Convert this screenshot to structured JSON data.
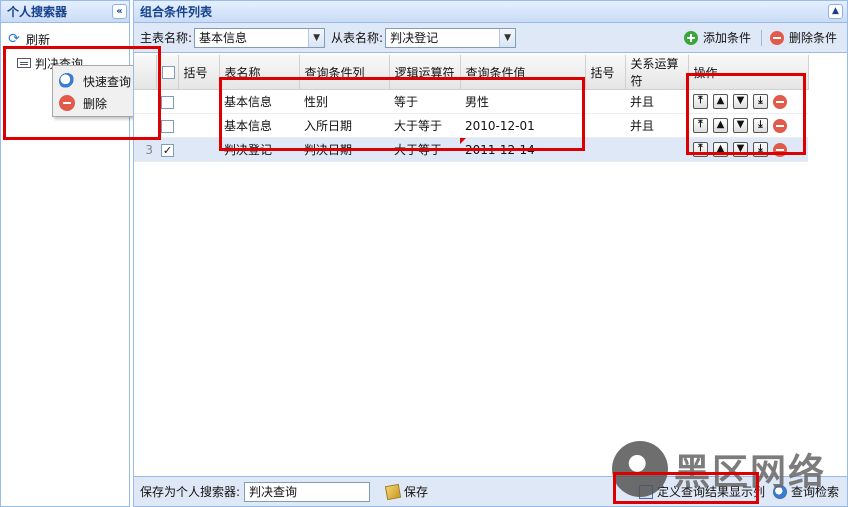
{
  "left_panel": {
    "title": "个人搜索器",
    "collapse_glyph": "«",
    "refresh_label": "刷新",
    "tree_items": [
      {
        "label": "判决查询",
        "icon": "form-icon"
      }
    ]
  },
  "context_menu": {
    "items": [
      {
        "label": "快速查询",
        "icon": "search-icon"
      },
      {
        "label": "删除",
        "icon": "delete-icon"
      }
    ]
  },
  "main_panel": {
    "title": "组合条件列表",
    "main_table_label": "主表名称:",
    "main_table_value": "基本信息",
    "sub_table_label": "从表名称:",
    "sub_table_value": "判决登记",
    "add_label": "添加条件",
    "remove_label": "删除条件"
  },
  "grid": {
    "columns": [
      "",
      "括号",
      "表名称",
      "查询条件列",
      "逻辑运算符",
      "查询条件值",
      "括号",
      "关系运算符",
      "操作"
    ],
    "rows": [
      {
        "num": "",
        "checked": "",
        "lparen": "",
        "table": "基本信息",
        "column": "性别",
        "op": "等于",
        "value": "男性",
        "rparen": "",
        "relation": "并且"
      },
      {
        "num": "",
        "checked": "",
        "lparen": "",
        "table": "基本信息",
        "column": "入所日期",
        "op": "大于等于",
        "value": "2010-12-01",
        "rparen": "",
        "relation": "并且"
      },
      {
        "num": "3",
        "checked": "✓",
        "lparen": "",
        "table": "判决登记",
        "column": "判决日期",
        "op": "大于等于",
        "value": "2011-12-14",
        "rparen": "",
        "relation": ""
      }
    ],
    "selected_row": 3,
    "op_buttons": {
      "top": "⤒",
      "up": "▲",
      "down": "▼",
      "bottom": "⤓"
    }
  },
  "bottom_bar": {
    "save_as_label": "保存为个人搜索器:",
    "save_as_value": "判决查询",
    "save_label": "保存",
    "define_columns_label": "定义查询结果显示列",
    "query_label": "查询检索"
  },
  "watermark": {
    "text": "黑区网络"
  },
  "colors": {
    "highlight": "#dd0000",
    "header_text": "#15428b",
    "panel_border": "#99bbe8"
  }
}
